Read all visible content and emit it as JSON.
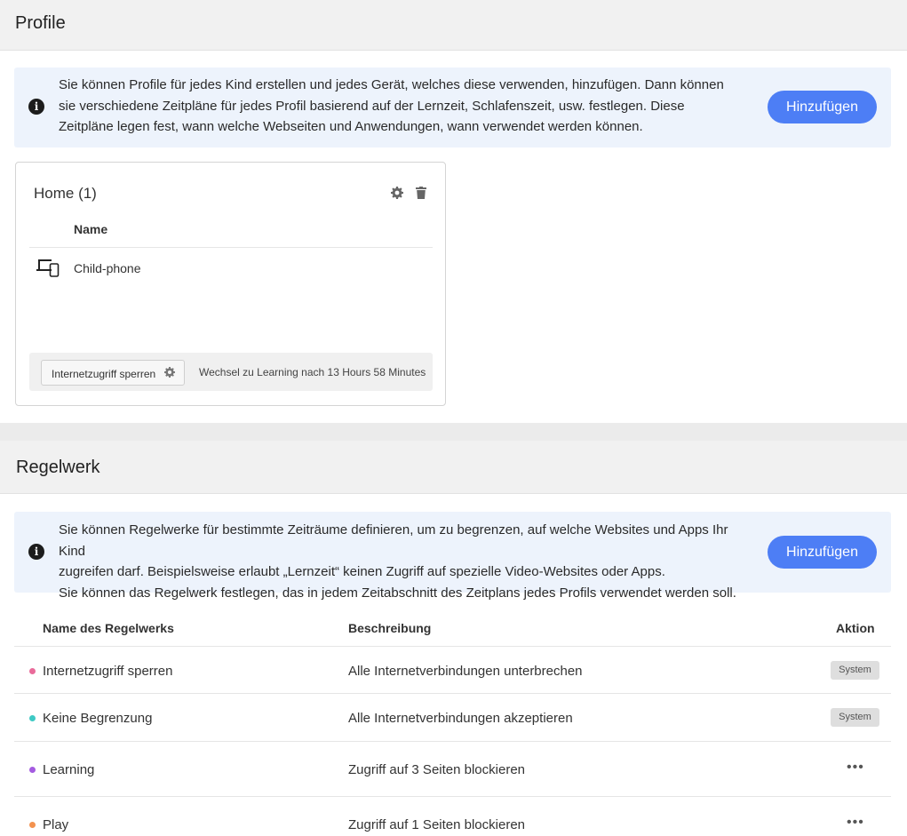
{
  "profile": {
    "title": "Profile",
    "info_icon": "info-icon",
    "info_text": "Sie können Profile für jedes Kind erstellen und jedes Gerät, welches diese verwenden, hinzufügen. Dann können sie verschiedene Zeitpläne für jedes Profil basierend auf der Lernzeit, Schlafenszeit, usw. festlegen. Diese Zeitpläne legen fest, wann welche Webseiten und Anwendungen, wann verwendet werden können.",
    "add_label": "Hinzufügen",
    "card": {
      "title": "Home (1)",
      "icons": [
        "gear-icon",
        "trash-icon"
      ],
      "column_header": "Name",
      "devices": [
        {
          "icon": "devices-icon",
          "name": "Child-phone"
        }
      ],
      "rule_label": "Internetzugriff sperren",
      "rule_icon": "gear-icon",
      "status_text": "Wechsel zu Learning nach 13 Hours 58 Minutes"
    }
  },
  "regelwerk": {
    "title": "Regelwerk",
    "info_icon": "info-icon",
    "info_lines": [
      "Sie können Regelwerke für bestimmte Zeiträume definieren, um zu begrenzen, auf welche Websites und Apps Ihr Kind",
      "zugreifen darf. Beispielsweise erlaubt „Lernzeit“ keinen Zugriff auf spezielle Video-Websites oder Apps.",
      "Sie können das Regelwerk festlegen, das in jedem Zeitabschnitt des Zeitplans jedes Profils verwendet werden soll."
    ],
    "add_label": "Hinzufügen",
    "table": {
      "headers": [
        "Name des Regelwerks",
        "Beschreibung",
        "Aktion"
      ],
      "rows": [
        {
          "name": "Internetzugriff sperren",
          "dot_color": "#e96b9a",
          "description": "Alle Internetverbindungen unterbrechen",
          "action": "System"
        },
        {
          "name": "Keine Begrenzung",
          "dot_color": "#3ec9c4",
          "description": "Alle Internetverbindungen akzeptieren",
          "action": "System"
        },
        {
          "name": "Learning",
          "dot_color": "#a45be0",
          "description": "Zugriff auf 3 Seiten blockieren",
          "action_icon": "more-icon",
          "action": "•••"
        },
        {
          "name": "Play",
          "dot_color": "#f3924f",
          "description": "Zugriff auf 1 Seiten blockieren",
          "action_icon": "more-icon",
          "action": "•••"
        }
      ]
    }
  },
  "colors": {
    "accent": "#4d7ef5",
    "info_background": "#edf3fc",
    "page_background": "#ebebeb"
  }
}
